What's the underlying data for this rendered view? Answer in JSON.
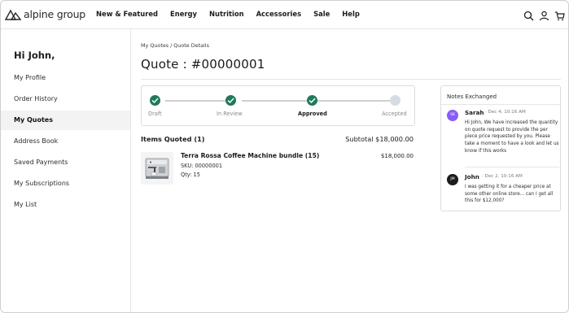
{
  "brand": {
    "logo_text": "alpine group",
    "mark": "mountains-logo"
  },
  "nav": {
    "items": [
      "New & Featured",
      "Energy",
      "Nutrition",
      "Accessories",
      "Sale",
      "Help"
    ]
  },
  "header_icons": [
    "search-icon",
    "user-icon",
    "cart-icon"
  ],
  "sidebar": {
    "greeting": "Hi John,",
    "items": [
      {
        "label": "My Profile",
        "active": false
      },
      {
        "label": "Order History",
        "active": false
      },
      {
        "label": "My Quotes",
        "active": true
      },
      {
        "label": "Address Book",
        "active": false
      },
      {
        "label": "Saved Payments",
        "active": false
      },
      {
        "label": "My Subscriptions",
        "active": false
      },
      {
        "label": "My List",
        "active": false
      }
    ]
  },
  "breadcrumb": "My Quotes / Quote Details",
  "quote": {
    "title": "Quote : #00000001"
  },
  "progress": {
    "steps": [
      {
        "label": "Draft",
        "status": "done"
      },
      {
        "label": "In Review",
        "status": "done"
      },
      {
        "label": "Approved",
        "status": "current"
      },
      {
        "label": "Accepted",
        "status": "todo"
      }
    ],
    "colors": {
      "done": "#1f7a5a",
      "todo": "#d7dce4"
    }
  },
  "items": {
    "title": "Items Quoted (1)",
    "subtotal": "Subtotal $18,000.00",
    "product": {
      "name": "Terra Rossa Coffee Machine bundle (15)",
      "sku": "SKU: 00000001",
      "qty": "Qty: 15",
      "price": "$18,000.00",
      "image": "coffee-machine-image"
    }
  },
  "notes": {
    "title": "Notes Exchanged",
    "entries": [
      {
        "initials": "SK",
        "author": "Sarah",
        "time": "· Dec 4, 10:16 AM",
        "avatar_color": "#8a5cf6",
        "text": "Hi John, We have increased the quantity on quote request to provide the per piece price requested by you. Please take a moment to have a look and let us know if this works"
      },
      {
        "initials": "JM",
        "author": "John",
        "time": "· Dec 2, 10:16 AM",
        "avatar_color": "#1c1c1c",
        "text": "I was getting it for a cheaper price at some other online store... can I get all this for $12,000?"
      }
    ]
  }
}
